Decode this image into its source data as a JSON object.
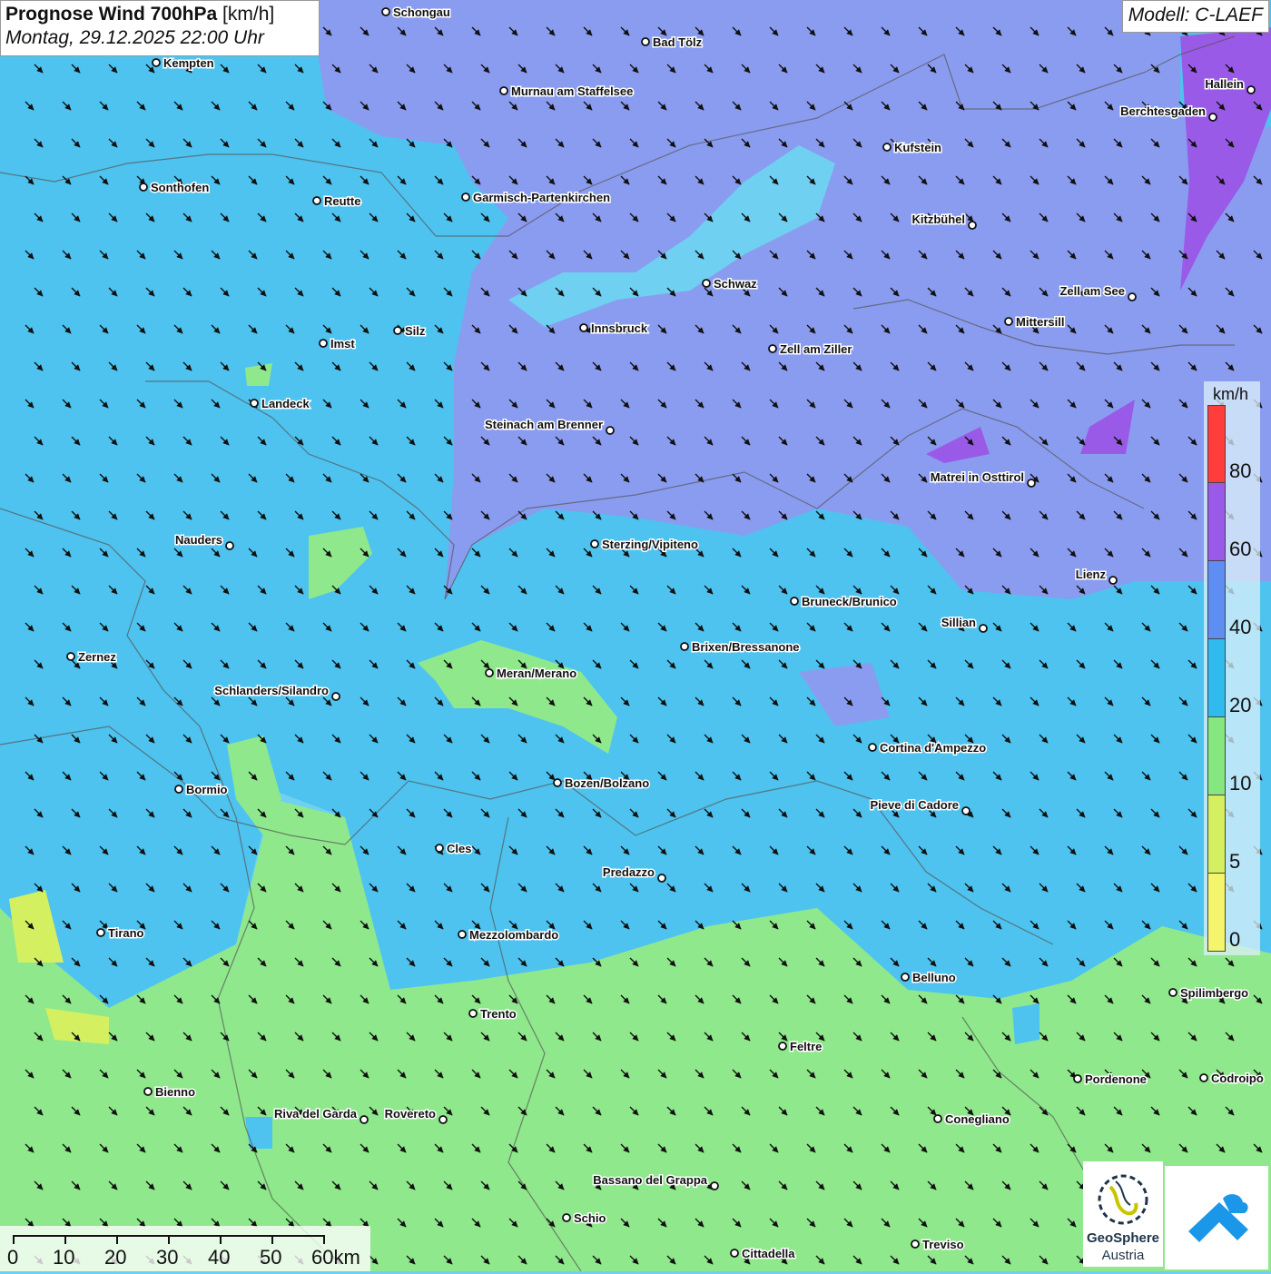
{
  "title": {
    "main": "Prognose Wind 700hPa",
    "unit": "[km/h]",
    "date": "Montag, 29.12.2025 22:00 Uhr"
  },
  "model": "Modell: C-LAEF",
  "legend": {
    "unit": "km/h",
    "segments": [
      {
        "color": "#ff3d3d"
      },
      {
        "color": "#9a5ae8"
      },
      {
        "color": "#5f8ef2"
      },
      {
        "color": "#2fbbee"
      },
      {
        "color": "#86e680"
      },
      {
        "color": "#d4f060"
      },
      {
        "color": "#f4f56c"
      }
    ],
    "labels": [
      "80",
      "60",
      "40",
      "20",
      "10",
      "5",
      "0"
    ]
  },
  "scale": {
    "labels": [
      "0",
      "10",
      "20",
      "30",
      "40",
      "50",
      "60km"
    ]
  },
  "cities": [
    {
      "name": "Schongau"
    },
    {
      "name": "Bad Tölz"
    },
    {
      "name": "Kempten"
    },
    {
      "name": "Murnau am Staffelsee"
    },
    {
      "name": "Hallein"
    },
    {
      "name": "Berchtesgaden"
    },
    {
      "name": "Kufstein"
    },
    {
      "name": "Sonthofen"
    },
    {
      "name": "Reutte"
    },
    {
      "name": "Garmisch-Partenkirchen"
    },
    {
      "name": "Kitzbühel"
    },
    {
      "name": "Schwaz"
    },
    {
      "name": "Zell am See"
    },
    {
      "name": "Innsbruck"
    },
    {
      "name": "Mittersill"
    },
    {
      "name": "Silz"
    },
    {
      "name": "Imst"
    },
    {
      "name": "Zell am Ziller"
    },
    {
      "name": "Landeck"
    },
    {
      "name": "Steinach am Brenner"
    },
    {
      "name": "Matrei in Osttirol"
    },
    {
      "name": "Nauders"
    },
    {
      "name": "Sterzing/Vipiteno"
    },
    {
      "name": "Lienz"
    },
    {
      "name": "Bruneck/Brunico"
    },
    {
      "name": "Sillian"
    },
    {
      "name": "Zernez"
    },
    {
      "name": "Brixen/Bressanone"
    },
    {
      "name": "Meran/Merano"
    },
    {
      "name": "Schlanders/Silandro"
    },
    {
      "name": "Cortina d'Ampezzo"
    },
    {
      "name": "Bozen/Bolzano"
    },
    {
      "name": "Bormio"
    },
    {
      "name": "Pieve di Cadore"
    },
    {
      "name": "Cles"
    },
    {
      "name": "Predazzo"
    },
    {
      "name": "Tirano"
    },
    {
      "name": "Mezzolombardo"
    },
    {
      "name": "Belluno"
    },
    {
      "name": "Spilimbergo"
    },
    {
      "name": "Trento"
    },
    {
      "name": "Feltre"
    },
    {
      "name": "Pordenone"
    },
    {
      "name": "Codroipo"
    },
    {
      "name": "Bienno"
    },
    {
      "name": "Riva del Garda"
    },
    {
      "name": "Rovereto"
    },
    {
      "name": "Conegliano"
    },
    {
      "name": "Bassano del Grappa"
    },
    {
      "name": "Schio"
    },
    {
      "name": "Treviso"
    },
    {
      "name": "Cittadella"
    }
  ],
  "logos": {
    "geosphere_line1": "GeoSphere",
    "geosphere_line2": "Austria"
  },
  "colors": {
    "zone_0_5": "#f4f56c",
    "zone_5_10": "#d4f060",
    "zone_10_20": "#8fe88c",
    "zone_20_40": "#6fd0f2",
    "zone_40_60": "#8a9cf0",
    "zone_60_80": "#9a5ae8",
    "zone_80_plus": "#ff3d3d",
    "arrow": "#111111"
  },
  "wind_arrows": {
    "direction": "northwest wind, arrows point to south-east"
  }
}
